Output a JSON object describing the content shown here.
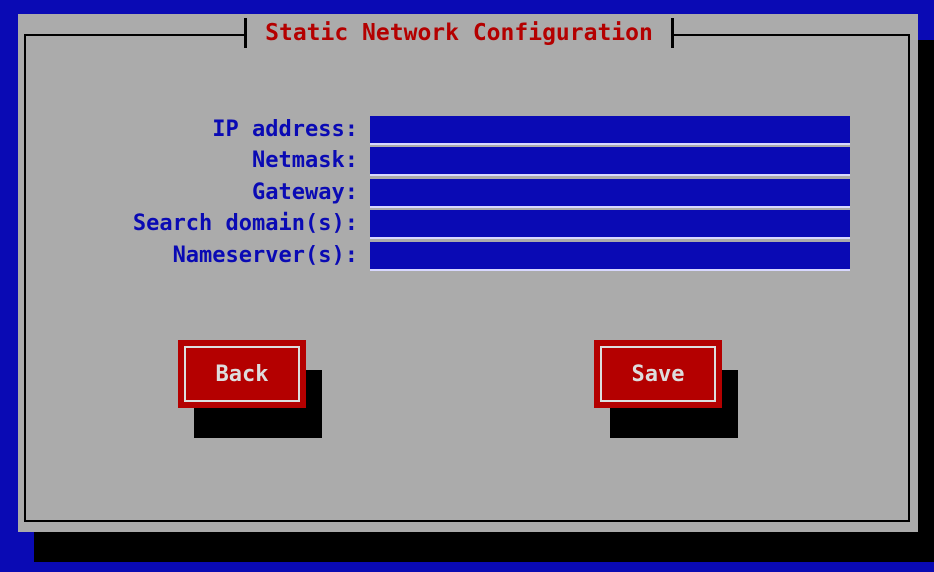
{
  "dialog": {
    "title": "Static Network Configuration"
  },
  "fields": [
    {
      "label": "IP address:",
      "value": ""
    },
    {
      "label": "Netmask:",
      "value": ""
    },
    {
      "label": "Gateway:",
      "value": ""
    },
    {
      "label": "Search domain(s):",
      "value": ""
    },
    {
      "label": "Nameserver(s):",
      "value": ""
    }
  ],
  "buttons": {
    "back_label": "Back",
    "save_label": "Save"
  },
  "colors": {
    "background": "#0a0ab4",
    "dialog": "#ababab",
    "title_text": "#b40000",
    "label_text": "#0a0ab4",
    "button": "#b40000",
    "shadow": "#000000"
  }
}
